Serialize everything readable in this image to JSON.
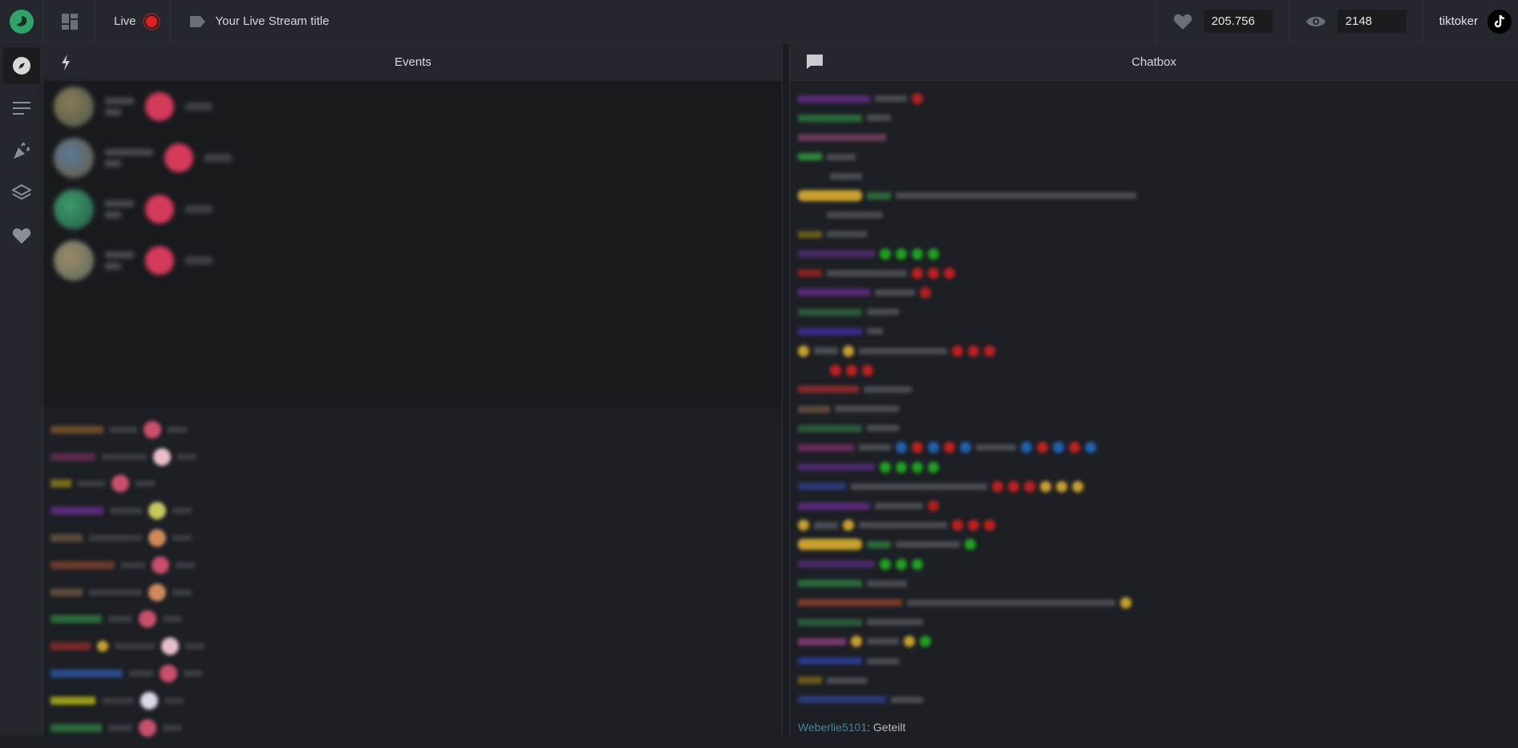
{
  "topbar": {
    "live_label": "Live",
    "stream_title": "Your Live Stream title",
    "likes": "205.756",
    "viewers": "2148",
    "username": "tiktoker",
    "icons": [
      "logo-icon",
      "dashboard-icon",
      "tag-icon",
      "heart-icon",
      "eye-icon",
      "tiktok-icon"
    ]
  },
  "sidebar": {
    "items": [
      "compass-icon",
      "list-icon",
      "party-popper-icon",
      "layers-icon",
      "heart-icon"
    ]
  },
  "events": {
    "title": "Events"
  },
  "chatbox": {
    "title": "Chatbox",
    "last_user": "Weberlie5101",
    "last_message": "Geteilt"
  },
  "colors": {
    "topbar_bg": "#24272d",
    "panel_bg": "#1c1f24",
    "accent_green": "#2ea36a",
    "live_red": "#e0201f"
  }
}
